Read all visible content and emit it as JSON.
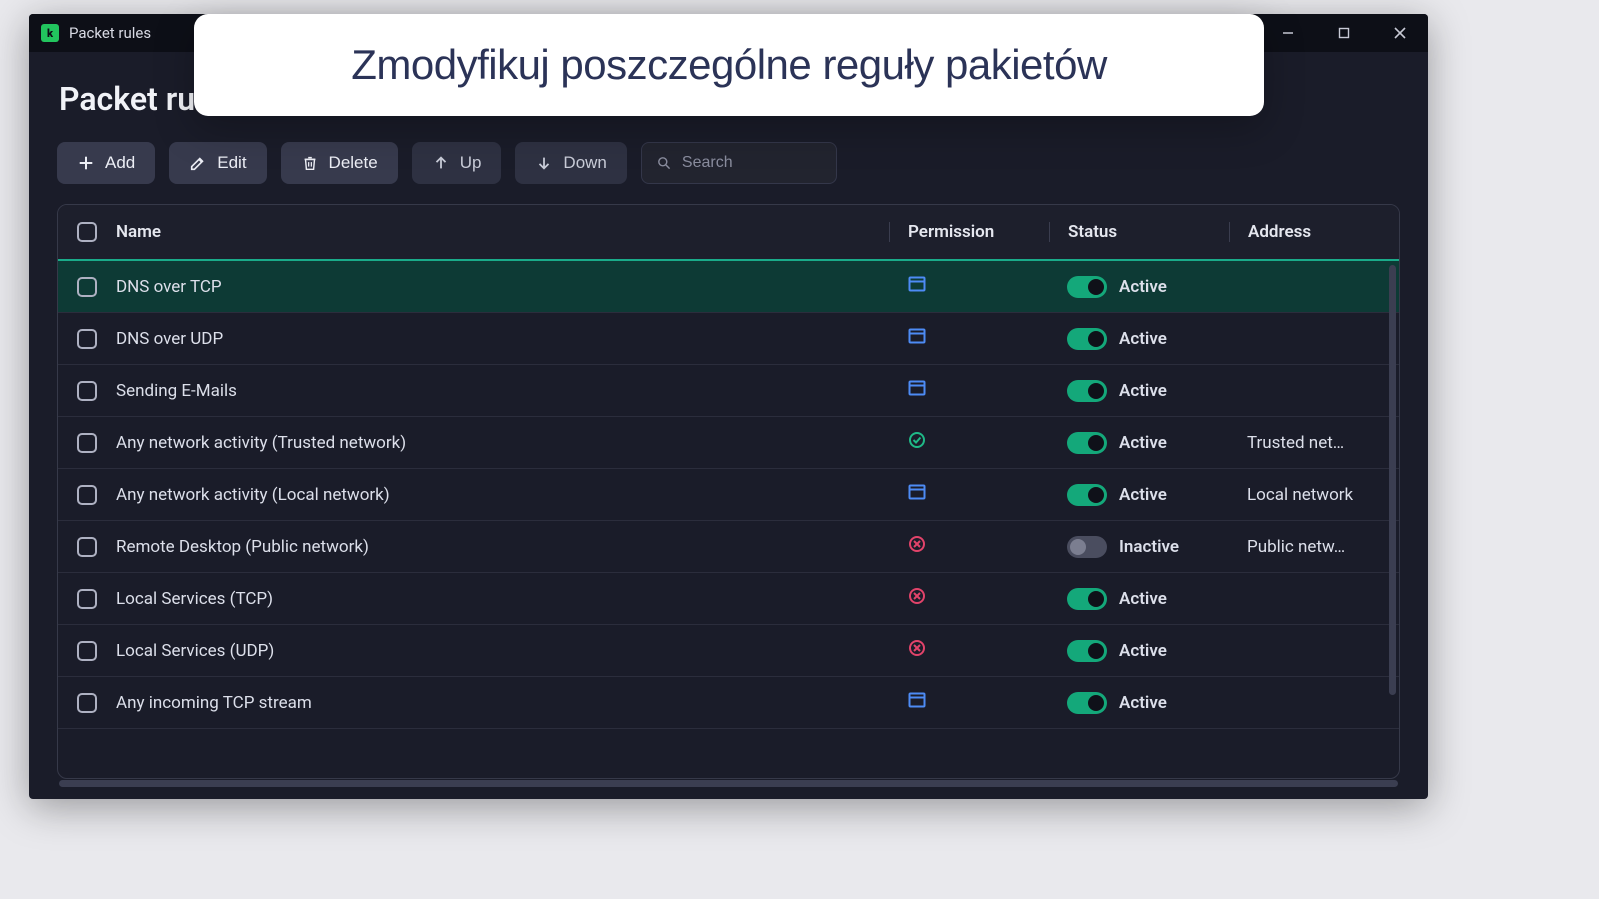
{
  "window": {
    "title": "Packet rules"
  },
  "page": {
    "title": "Packet rules"
  },
  "toolbar": {
    "add": "Add",
    "edit": "Edit",
    "delete": "Delete",
    "up": "Up",
    "down": "Down"
  },
  "search": {
    "placeholder": "Search",
    "value": ""
  },
  "columns": {
    "name": "Name",
    "permission": "Permission",
    "status": "Status",
    "address": "Address"
  },
  "status_labels": {
    "active": "Active",
    "inactive": "Inactive"
  },
  "rows": [
    {
      "name": "DNS over TCP",
      "perm": "allow-window",
      "active": true,
      "address": "",
      "selected": true
    },
    {
      "name": "DNS over UDP",
      "perm": "allow-window",
      "active": true,
      "address": ""
    },
    {
      "name": "Sending E-Mails",
      "perm": "allow-window",
      "active": true,
      "address": ""
    },
    {
      "name": "Any network activity (Trusted network)",
      "perm": "allow-check",
      "active": true,
      "address": "Trusted net…"
    },
    {
      "name": "Any network activity (Local network)",
      "perm": "allow-window",
      "active": true,
      "address": "Local network"
    },
    {
      "name": "Remote Desktop (Public network)",
      "perm": "block",
      "active": false,
      "address": "Public netw…"
    },
    {
      "name": "Local Services (TCP)",
      "perm": "block",
      "active": true,
      "address": ""
    },
    {
      "name": "Local Services (UDP)",
      "perm": "block",
      "active": true,
      "address": ""
    },
    {
      "name": "Any incoming TCP stream",
      "perm": "allow-window",
      "active": true,
      "address": ""
    }
  ],
  "banner": {
    "text": "Zmodyfikuj poszczególne reguły pakietów"
  }
}
